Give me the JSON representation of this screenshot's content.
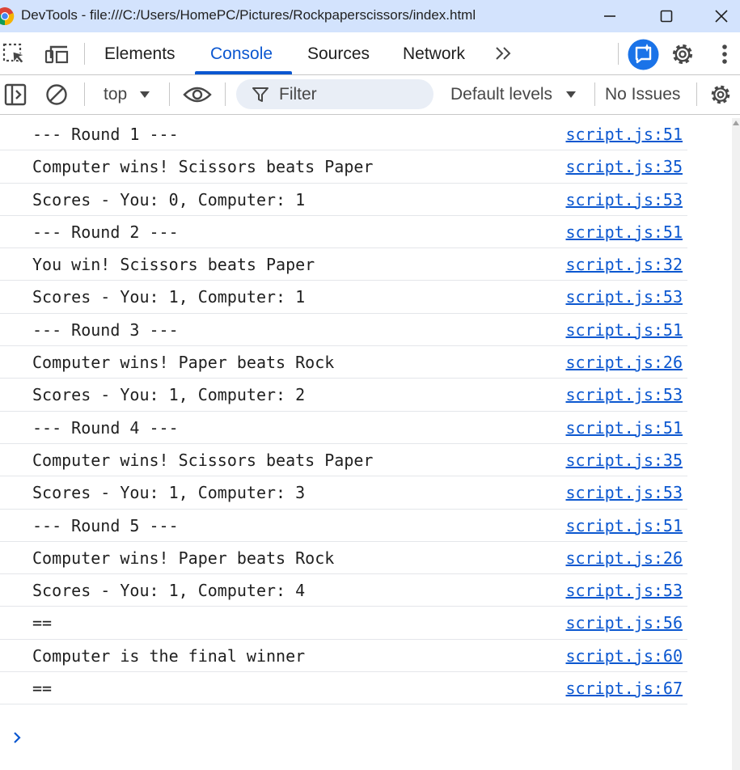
{
  "window": {
    "title": "DevTools - file:///C:/Users/HomePC/Pictures/Rockpaperscissors/index.html",
    "icons": [
      "chrome-logo",
      "minimize-icon",
      "maximize-icon",
      "close-icon"
    ]
  },
  "toolbar": {
    "tabs": [
      {
        "label": "Elements",
        "active": false
      },
      {
        "label": "Console",
        "active": true
      },
      {
        "label": "Sources",
        "active": false
      },
      {
        "label": "Network",
        "active": false
      }
    ],
    "icons": [
      "inspect-element-icon",
      "device-toolbar-icon",
      "more-tabs-icon",
      "ai-assistant-icon",
      "settings-icon",
      "kebab-menu-icon"
    ],
    "accent": "#0b57d0"
  },
  "console_toolbar": {
    "context": "top",
    "filter_placeholder": "Filter",
    "levels": "Default levels",
    "issues": "No Issues",
    "icons": [
      "sidebar-toggle-icon",
      "clear-console-icon",
      "dropdown-arrow-icon",
      "eye-icon",
      "filter-icon",
      "settings-icon"
    ]
  },
  "messages": [
    {
      "text": "--- Round 1 ---",
      "source": "script.js:51"
    },
    {
      "text": "Computer wins! Scissors beats Paper",
      "source": "script.js:35"
    },
    {
      "text": "Scores - You: 0, Computer: 1",
      "source": "script.js:53"
    },
    {
      "text": "--- Round 2 ---",
      "source": "script.js:51"
    },
    {
      "text": "You win! Scissors beats Paper",
      "source": "script.js:32"
    },
    {
      "text": "Scores - You: 1, Computer: 1",
      "source": "script.js:53"
    },
    {
      "text": "--- Round 3 ---",
      "source": "script.js:51"
    },
    {
      "text": "Computer wins! Paper beats Rock",
      "source": "script.js:26"
    },
    {
      "text": "Scores - You: 1, Computer: 2",
      "source": "script.js:53"
    },
    {
      "text": "--- Round 4 ---",
      "source": "script.js:51"
    },
    {
      "text": "Computer wins! Scissors beats Paper",
      "source": "script.js:35"
    },
    {
      "text": "Scores - You: 1, Computer: 3",
      "source": "script.js:53"
    },
    {
      "text": "--- Round 5 ---",
      "source": "script.js:51"
    },
    {
      "text": "Computer wins! Paper beats Rock",
      "source": "script.js:26"
    },
    {
      "text": "Scores - You: 1, Computer: 4",
      "source": "script.js:53"
    },
    {
      "text": "==",
      "source": "script.js:56"
    },
    {
      "text": "Computer is the final winner",
      "source": "script.js:60"
    },
    {
      "text": "==",
      "source": "script.js:67"
    }
  ],
  "prompt_icon": "chevron-right-icon"
}
